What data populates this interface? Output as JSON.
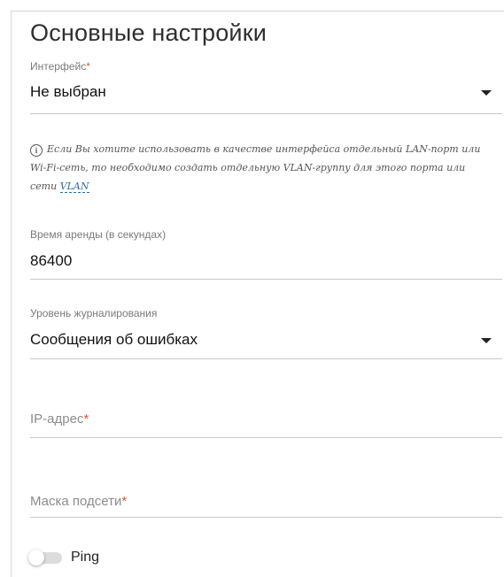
{
  "section": {
    "title": "Основные настройки"
  },
  "interface": {
    "label": "Интерфейс",
    "required_mark": "*",
    "value": "Не выбран"
  },
  "note": {
    "text": "Если Вы хотите использовать в качестве интерфейса отдельный LAN-порт или Wi-Fi-сеть, то необходимо создать отдельную VLAN-группу для этого порта или сети",
    "link": "VLAN",
    "icon": "info-icon"
  },
  "lease_time": {
    "label": "Время аренды (в секундах)",
    "value": "86400"
  },
  "log_level": {
    "label": "Уровень журналирования",
    "value": "Сообщения об ошибках"
  },
  "ip_address": {
    "placeholder": "IP-адрес",
    "required_mark": "*"
  },
  "subnet_mask": {
    "placeholder": "Маска подсети",
    "required_mark": "*"
  },
  "ping": {
    "label": "Ping",
    "enabled": false
  },
  "colors": {
    "accent_link": "#2a6ea8",
    "required": "#e0552f",
    "underline": "#c9c9c9"
  }
}
